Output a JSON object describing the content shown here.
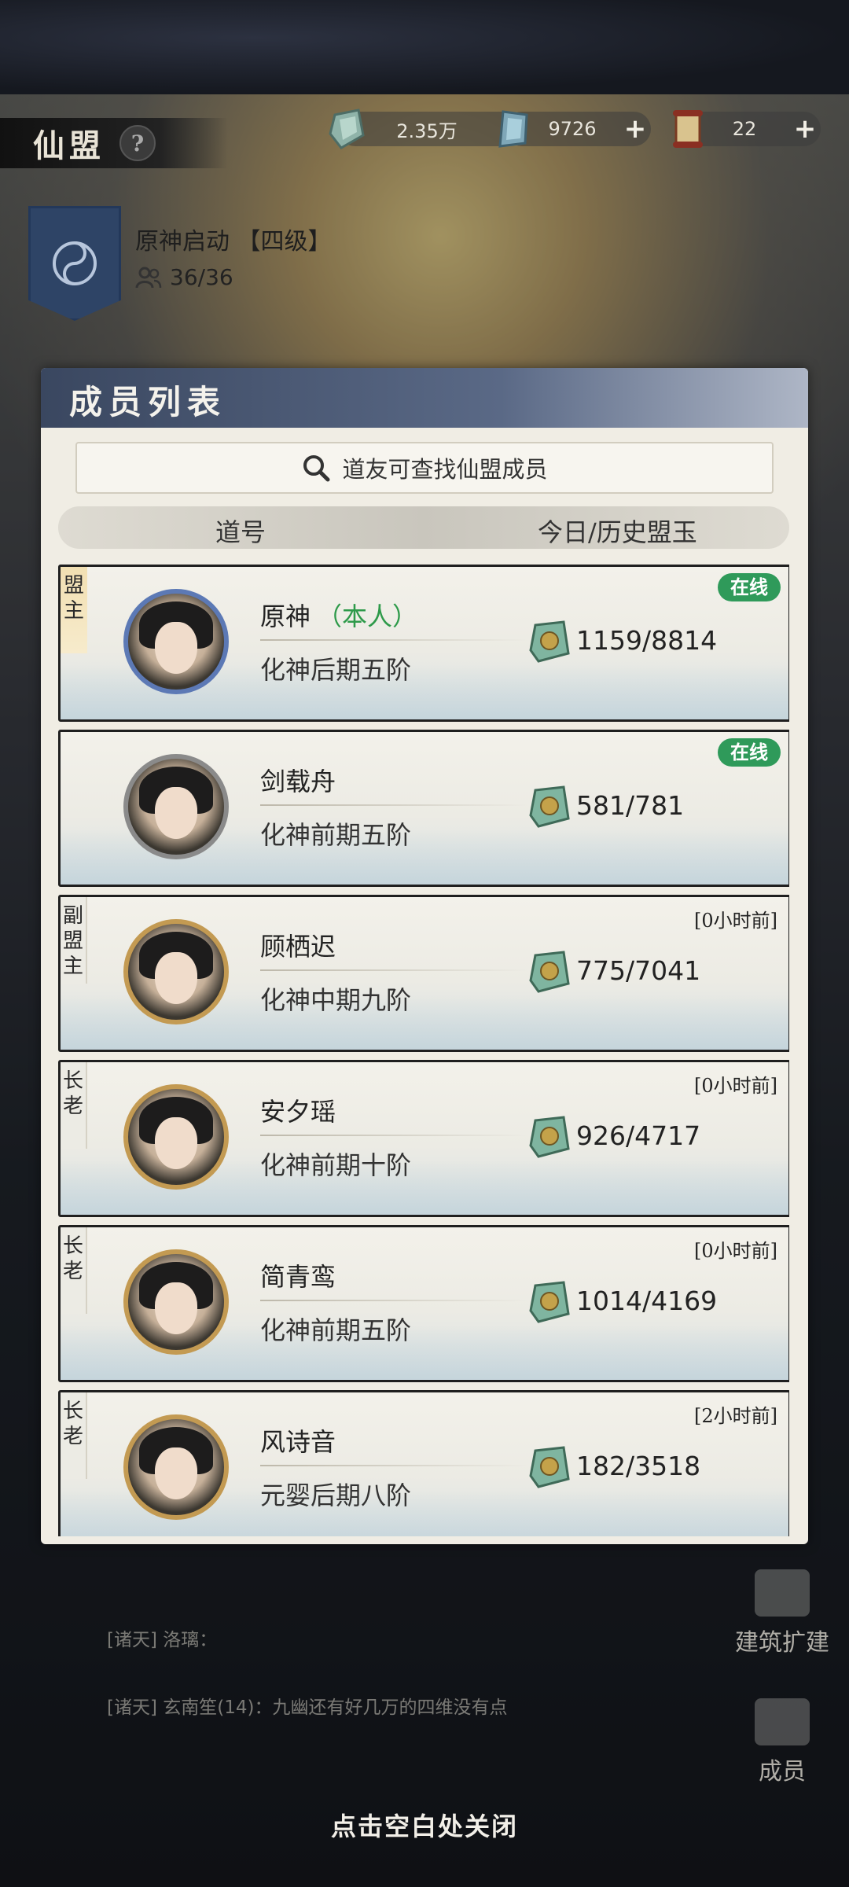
{
  "header": {
    "title": "仙盟",
    "help_label": "?",
    "resources": [
      {
        "icon": "spirit-stone-icon",
        "value": "2.35万",
        "plus": "+"
      },
      {
        "icon": "jade-icon",
        "value": "9726",
        "plus": "+"
      },
      {
        "icon": "scroll-icon",
        "value": "22",
        "plus": "+"
      }
    ]
  },
  "alliance": {
    "name": "原神启动 【四级】",
    "members": "36/36"
  },
  "modal": {
    "title": "成员列表",
    "search_placeholder": "道友可查找仙盟成员",
    "columns": {
      "name": "道号",
      "jade": "今日/历史盟玉"
    }
  },
  "members": [
    {
      "role": "盟主",
      "name": "原神",
      "self_tag": "（本人）",
      "realm": "化神后期五阶",
      "jade": "1159/8814",
      "status": "在线",
      "online": true
    },
    {
      "role": "",
      "name": "剑载舟",
      "self_tag": "",
      "realm": "化神前期五阶",
      "jade": "581/781",
      "status": "在线",
      "online": true
    },
    {
      "role": "副盟主",
      "name": "顾栖迟",
      "self_tag": "",
      "realm": "化神中期九阶",
      "jade": "775/7041",
      "status": "[0小时前]",
      "online": false
    },
    {
      "role": "长老",
      "name": "安夕瑶",
      "self_tag": "",
      "realm": "化神前期十阶",
      "jade": "926/4717",
      "status": "[0小时前]",
      "online": false
    },
    {
      "role": "长老",
      "name": "简青鸾",
      "self_tag": "",
      "realm": "化神前期五阶",
      "jade": "1014/4169",
      "status": "[0小时前]",
      "online": false
    },
    {
      "role": "长老",
      "name": "风诗音",
      "self_tag": "",
      "realm": "元婴后期八阶",
      "jade": "182/3518",
      "status": "[2小时前]",
      "online": false
    }
  ],
  "chat": [
    "[诸天] 洛璃：",
    "[诸天] 玄南笙(14)：九幽还有好几万的四维没有点"
  ],
  "side_buttons": {
    "build": "建筑扩建",
    "members": "成员"
  },
  "close_hint": "点击空白处关闭",
  "colors": {
    "online": "#2f9a5a",
    "self_tag": "#2e9a4a",
    "modal_header": "#3a4760"
  }
}
